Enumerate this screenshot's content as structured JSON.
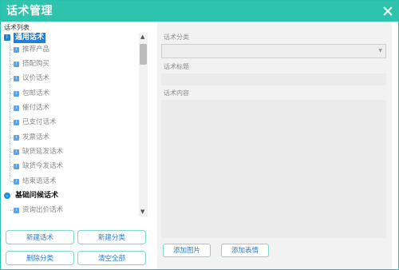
{
  "window": {
    "title": "话术管理",
    "accent": "#2dc3ad"
  },
  "left": {
    "list_label": "话术列表",
    "groups": [
      {
        "label": "通用话术",
        "selected": true,
        "items": [
          "推荐产品",
          "搭配购买",
          "议价话术",
          "包邮话术",
          "催付话术",
          "已支付话术",
          "发票话术",
          "缺货延发话术",
          "缺货今发话术",
          "结束语话术"
        ]
      },
      {
        "label": "基础问候话术",
        "selected": false,
        "items": [
          "资询出价话术"
        ]
      }
    ],
    "buttons": {
      "new_script": "新建话术",
      "new_category": "新建分类",
      "delete_category": "删除分类",
      "clear_all": "清空全部"
    }
  },
  "right": {
    "category_label": "话术分类",
    "category_value": "",
    "title_label": "话术标题",
    "title_value": "",
    "content_label": "话术内容",
    "content_value": "",
    "buttons": {
      "add_image": "添加图片",
      "add_emoji": "添加表情"
    }
  }
}
